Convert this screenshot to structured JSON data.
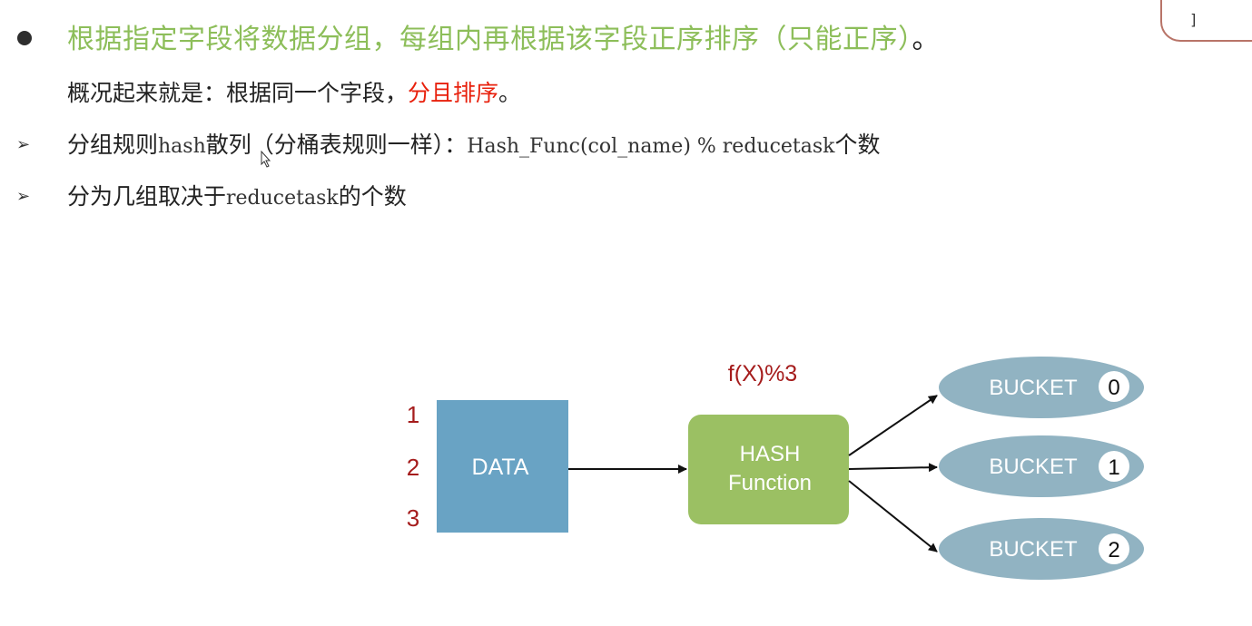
{
  "corner_tab": {
    "text": "]"
  },
  "bullets": {
    "line1": {
      "main": "根据指定字段将数据分组，每组内再根据该字段正序排序（只能正序）",
      "end": "。"
    },
    "line2": {
      "prefix": "概况起来就是：根据同一个字段，",
      "highlight": "分且排序",
      "end": "。"
    },
    "line3": {
      "marker": "➢",
      "p1": "分组规则",
      "m1": "hash",
      "p2": "散列（分桶表规则一样）：",
      "m2": "Hash_Func(col_name) % reducetask",
      "p3": "个数"
    },
    "line4": {
      "marker": "➢",
      "p1": "分为几组取决于",
      "m1": "reducetask",
      "p2": "的个数"
    }
  },
  "diagram": {
    "numbers": [
      "1",
      "2",
      "3"
    ],
    "data_label": "DATA",
    "function_label": "f(X)%3",
    "hash_line1": "HASH",
    "hash_line2": "Function",
    "buckets": [
      {
        "label": "BUCKET",
        "index": "0"
      },
      {
        "label": "BUCKET",
        "index": "1"
      },
      {
        "label": "BUCKET",
        "index": "2"
      }
    ],
    "colors": {
      "data_box": "#69a3c4",
      "hash_box": "#9bc063",
      "bucket": "#91b3c2",
      "numbers": "#a51c1c",
      "function_label": "#a51c1c"
    }
  }
}
